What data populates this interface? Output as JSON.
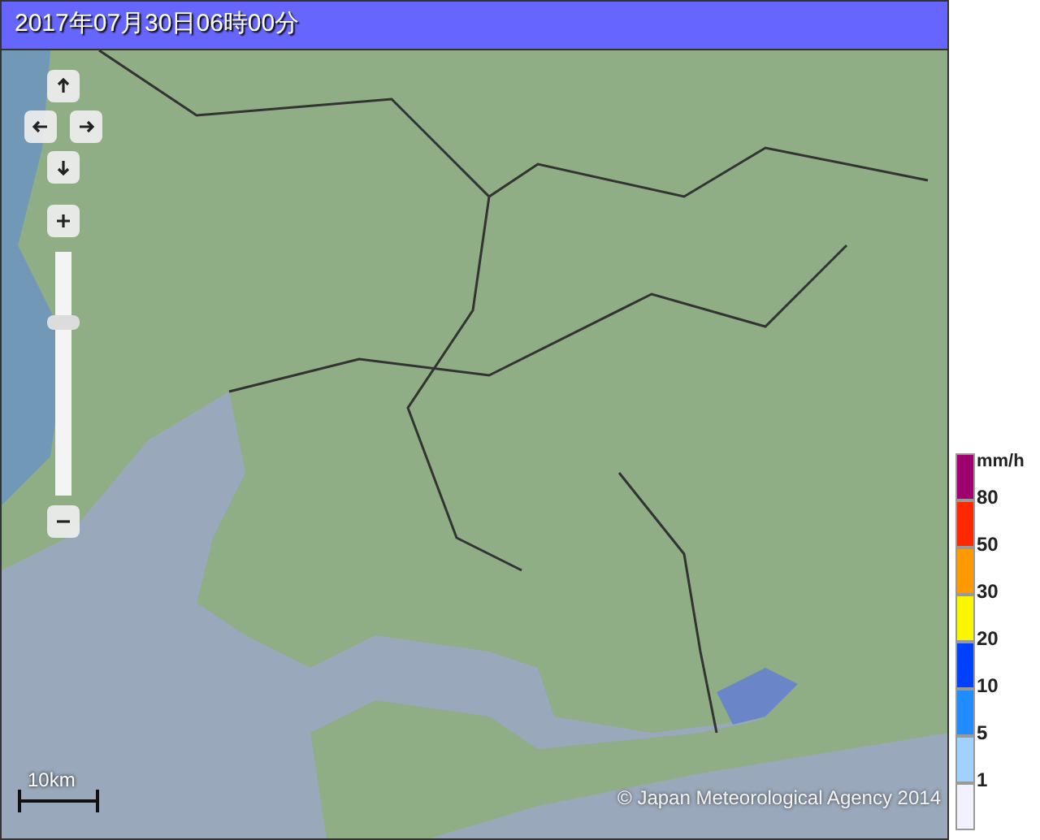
{
  "title": "2017年07月30日06時00分",
  "map": {
    "zoom": {
      "level": 0.72
    },
    "scale": "10km",
    "copyright": "© Japan Meteorological Agency 2014"
  },
  "legend": {
    "unit": "mm/h",
    "items": [
      {
        "color": "#a0006e",
        "label": "80"
      },
      {
        "color": "#ff2800",
        "label": "50"
      },
      {
        "color": "#ff9900",
        "label": "30"
      },
      {
        "color": "#faf500",
        "label": "20"
      },
      {
        "color": "#0041ff",
        "label": "10"
      },
      {
        "color": "#218cff",
        "label": "5"
      },
      {
        "color": "#a0d2ff",
        "label": "1"
      },
      {
        "color": "#f2f2ff"
      }
    ]
  }
}
